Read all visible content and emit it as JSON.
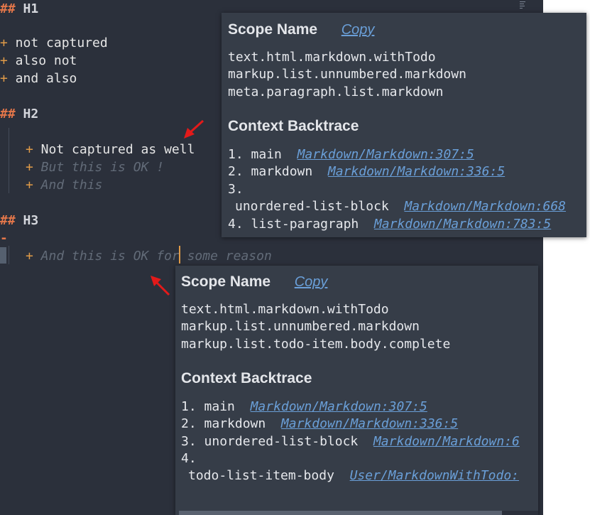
{
  "editor": {
    "lines": [
      {
        "hash": "##",
        "text": " H1"
      },
      {
        "plus": "+",
        "text": " not captured"
      },
      {
        "plus": "+",
        "text": " also not"
      },
      {
        "plus": "+",
        "text": " and also"
      },
      {
        "hash": "##",
        "text": " H2"
      },
      {
        "plus": "+",
        "text": " Not captured as well"
      },
      {
        "plus": "+",
        "text": " But this is OK !"
      },
      {
        "plus": "+",
        "text": " And this"
      },
      {
        "hash": "##",
        "text": " H3"
      },
      {
        "dash": "-"
      },
      {
        "plus": "+",
        "text": " And this is OK for some reason"
      }
    ],
    "arrow_color": "#e31a1a"
  },
  "popup1": {
    "title": "Scope Name",
    "copy": "Copy",
    "scopes": [
      "text.html.markdown.withTodo",
      "markup.list.unnumbered.markdown",
      "meta.paragraph.list.markdown"
    ],
    "backtrace_title": "Context Backtrace",
    "backtrace": [
      {
        "num": "1.",
        "name": "main",
        "link": "Markdown/Markdown:307:5"
      },
      {
        "num": "2.",
        "name": "markdown",
        "link": "Markdown/Markdown:336:5"
      },
      {
        "num": "3.",
        "name": "unordered-list-block",
        "link": "Markdown/Markdown:668"
      },
      {
        "num": "4.",
        "name": "list-paragraph",
        "link": "Markdown/Markdown:783:5"
      }
    ]
  },
  "popup2": {
    "title": "Scope Name",
    "copy": "Copy",
    "scopes": [
      "text.html.markdown.withTodo",
      "markup.list.unnumbered.markdown",
      "markup.list.todo-item.body.complete"
    ],
    "backtrace_title": "Context Backtrace",
    "backtrace": [
      {
        "num": "1.",
        "name": "main",
        "link": "Markdown/Markdown:307:5"
      },
      {
        "num": "2.",
        "name": "markdown",
        "link": "Markdown/Markdown:336:5"
      },
      {
        "num": "3.",
        "name": "unordered-list-block",
        "link": "Markdown/Markdown:6"
      },
      {
        "num": "4.",
        "name": "todo-list-item-body",
        "link": "User/MarkdownWithTodo:"
      }
    ]
  }
}
